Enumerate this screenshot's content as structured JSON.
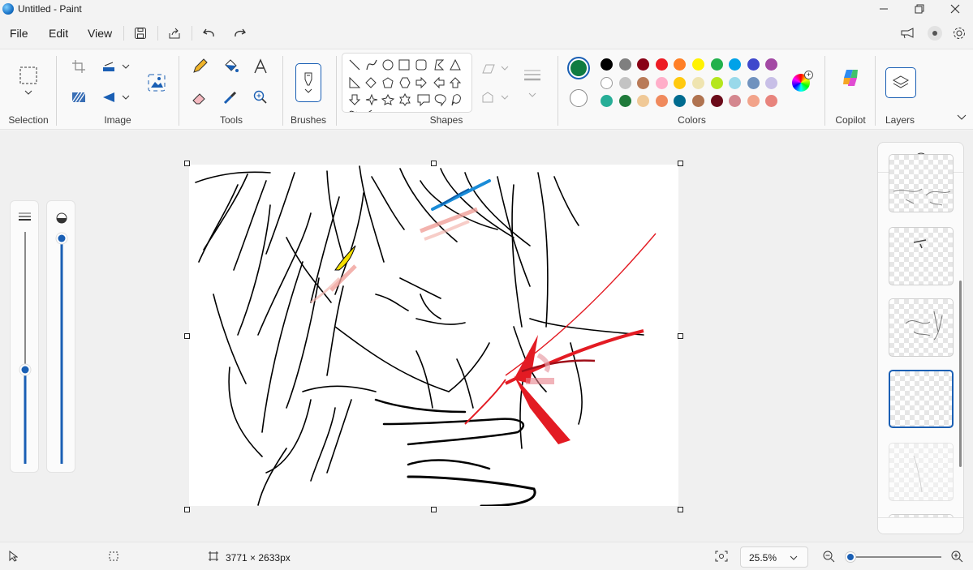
{
  "window": {
    "title": "Untitled - Paint"
  },
  "menu": {
    "file": "File",
    "edit": "Edit",
    "view": "View"
  },
  "ribbon": {
    "groups": {
      "selection": "Selection",
      "image": "Image",
      "tools": "Tools",
      "brushes": "Brushes",
      "shapes": "Shapes",
      "colors": "Colors",
      "copilot": "Copilot",
      "layers": "Layers"
    },
    "colors": {
      "primary": "#107c41",
      "secondary": "#ffffff",
      "palette_row1": [
        "#000000",
        "#7f7f7f",
        "#880015",
        "#ed1c24",
        "#ff7f27",
        "#fff200",
        "#22b14c",
        "#00a2e8",
        "#3f48cc",
        "#a349a4"
      ],
      "palette_row2": [
        "#ffffff",
        "#c3c3c3",
        "#b97a57",
        "#ffaec9",
        "#ffc90e",
        "#efe4b0",
        "#b5e61d",
        "#99d9ea",
        "#7092be",
        "#c8bfe7"
      ],
      "palette_row3": [
        "#27ae97",
        "#1f7a3a",
        "#f0c997",
        "#f08a5d",
        "#006b8f",
        "#b07350",
        "#6b0b1a",
        "#d4878f",
        "#f2a38a",
        "#e8847d"
      ]
    }
  },
  "status": {
    "canvas_size": "3771 × 2633px",
    "zoom": "25.5%",
    "zoom_slider_level": 0.02
  },
  "layers_panel": {
    "selected_index": 3
  }
}
